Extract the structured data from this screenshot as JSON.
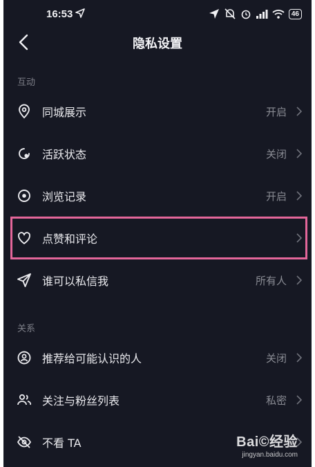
{
  "status_bar": {
    "time": "16:53",
    "battery": "46"
  },
  "header": {
    "title": "隐私设置"
  },
  "sections": [
    {
      "header": "互动",
      "items": [
        {
          "label": "同城展示",
          "value": "开启",
          "icon": "location-pin-icon"
        },
        {
          "label": "活跃状态",
          "value": "关闭",
          "icon": "activity-status-icon"
        },
        {
          "label": "浏览记录",
          "value": "开启",
          "icon": "eye-icon"
        },
        {
          "label": "点赞和评论",
          "value": "",
          "icon": "heart-icon"
        },
        {
          "label": "谁可以私信我",
          "value": "所有人",
          "icon": "send-icon"
        }
      ]
    },
    {
      "header": "关系",
      "items": [
        {
          "label": "推荐给可能认识的人",
          "value": "关闭",
          "icon": "person-circle-icon"
        },
        {
          "label": "关注与粉丝列表",
          "value": "私密",
          "icon": "people-icon"
        },
        {
          "label": "不看 TA",
          "value": "",
          "icon": "eye-off-icon"
        }
      ]
    }
  ],
  "watermark": {
    "logo": "Bai©经验",
    "url": "jingyan.baidu.com"
  },
  "colors": {
    "background": "#161823",
    "highlight": "#e4669a"
  }
}
